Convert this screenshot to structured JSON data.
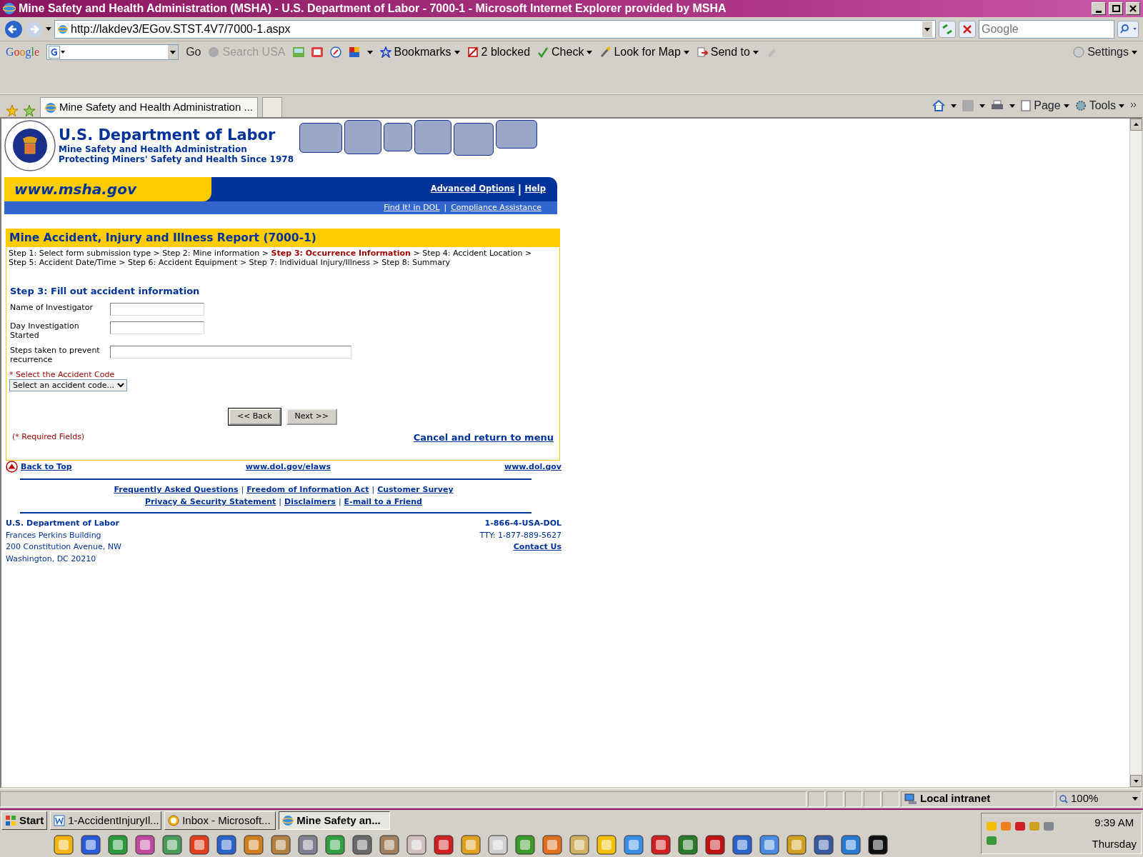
{
  "window": {
    "title": "Mine Safety and Health Administration (MSHA) - U.S. Department of Labor - 7000-1 - Microsoft Internet Explorer provided by MSHA"
  },
  "address_bar": {
    "url": "http://lakdev3/EGov.STST.4V7/7000-1.aspx"
  },
  "search_box": {
    "placeholder": "Google"
  },
  "google_toolbar": {
    "brand": "Google",
    "go": "Go",
    "items": [
      {
        "label": "Search USA",
        "disabled": true,
        "dropdown": false
      },
      {
        "label": "Bookmarks",
        "disabled": false,
        "dropdown": true
      },
      {
        "label": "2 blocked",
        "disabled": false,
        "dropdown": false
      },
      {
        "label": "Check",
        "disabled": false,
        "dropdown": true
      },
      {
        "label": "Look for Map",
        "disabled": false,
        "dropdown": true
      },
      {
        "label": "Send to",
        "disabled": false,
        "dropdown": true
      }
    ],
    "settings": "Settings"
  },
  "tab_bar": {
    "tabs": [
      {
        "label": "Mine Safety and Health Administration ...",
        "selected": true
      }
    ]
  },
  "command_bar": {
    "items": [
      "Page",
      "Tools"
    ]
  },
  "header": {
    "agency": "U.S. Department of Labor",
    "subagency": "Mine Safety and Health Administration",
    "tagline": "Protecting Miners' Safety and Health Since 1978",
    "site": "www.msha.gov",
    "top_links": [
      {
        "kind": "link",
        "label": "Advanced Options"
      },
      {
        "kind": "separator",
        "label": "|"
      },
      {
        "kind": "link",
        "label": "Help"
      }
    ],
    "sub_links": [
      {
        "kind": "link",
        "label": "Find It! in DOL"
      },
      {
        "kind": "separator",
        "label": "|"
      },
      {
        "kind": "link",
        "label": "Compliance Assistance"
      }
    ]
  },
  "form": {
    "title": "Mine Accident, Injury and Illness Report (7000-1)",
    "steps": [
      {
        "kind": "step",
        "label": "Step 1: Select form submission type",
        "selected": false
      },
      {
        "kind": "separator",
        "label": ">"
      },
      {
        "kind": "step",
        "label": "Step 2: Mine information",
        "selected": false
      },
      {
        "kind": "separator",
        "label": ">"
      },
      {
        "kind": "step",
        "label": "Step 3: Occurrence Information",
        "selected": true
      },
      {
        "kind": "separator",
        "label": ">"
      },
      {
        "kind": "step",
        "label": "Step 4: Accident Location",
        "selected": false
      },
      {
        "kind": "separator",
        "label": ">"
      },
      {
        "kind": "step",
        "label": "Step 5: Accident Date/Time",
        "selected": false
      },
      {
        "kind": "separator",
        "label": ">"
      },
      {
        "kind": "step",
        "label": "Step 6: Accident Equipment",
        "selected": false
      },
      {
        "kind": "separator",
        "label": ">"
      },
      {
        "kind": "step",
        "label": "Step 7: Individual Injury/Illness",
        "selected": false
      },
      {
        "kind": "separator",
        "label": ">"
      },
      {
        "kind": "step",
        "label": "Step 8: Summary",
        "selected": false
      }
    ],
    "section_title": "Step 3: Fill out accident information",
    "fields": [
      {
        "kind": "text",
        "label": "Name of Investigator"
      },
      {
        "kind": "text",
        "label": "Day Investigation Started"
      },
      {
        "kind": "wide",
        "label": "Steps taken to prevent recurrence"
      },
      {
        "kind": "select",
        "label": "* Select the Accident Code",
        "value": "Select an accident code..."
      }
    ],
    "buttons": [
      "<< Back",
      "Next >>"
    ],
    "required_note": "(* Required Fields)",
    "cancel_link": "Cancel and return to menu"
  },
  "footer": {
    "back_to_top": "Back to Top",
    "center_link": "www.dol.gov/elaws",
    "right_link": "www.dol.gov",
    "link_rows": [
      [
        {
          "kind": "link",
          "label": "Frequently Asked Questions"
        },
        {
          "kind": "separator",
          "label": "|"
        },
        {
          "kind": "link",
          "label": "Freedom of Information Act"
        },
        {
          "kind": "separator",
          "label": "|"
        },
        {
          "kind": "link",
          "label": "Customer Survey"
        }
      ],
      [
        {
          "kind": "link",
          "label": "Privacy & Security Statement"
        },
        {
          "kind": "separator",
          "label": "|"
        },
        {
          "kind": "link",
          "label": "Disclaimers"
        },
        {
          "kind": "separator",
          "label": "|"
        },
        {
          "kind": "link",
          "label": "E-mail to a Friend"
        }
      ]
    ],
    "organization": "U.S. Department of Labor",
    "address": [
      "Frances Perkins Building",
      "200 Constitution Avenue, NW",
      "Washington, DC 20210"
    ],
    "phone": "1-866-4-USA-DOL",
    "tty": "TTY: 1-877-889-5627",
    "contact": "Contact Us"
  },
  "status_bar": {
    "zone": "Local intranet",
    "zoom": "100%"
  },
  "taskbar": {
    "start": "Start",
    "tasks": [
      {
        "label": "1-AccidentInjuryIl...",
        "selected": false
      },
      {
        "label": "Inbox - Microsoft...",
        "selected": false
      },
      {
        "label": "Mine Safety an...",
        "selected": true
      }
    ],
    "clock": {
      "time": "9:39 AM",
      "day": "Thursday"
    }
  }
}
